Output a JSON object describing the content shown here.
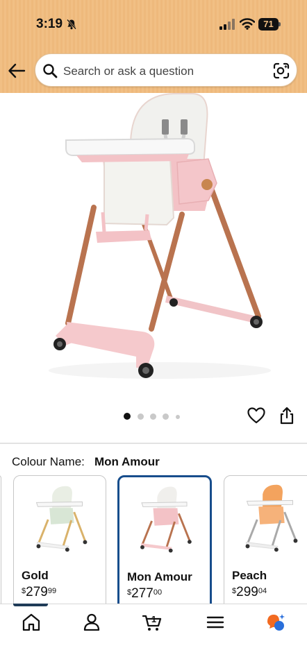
{
  "status_bar": {
    "time": "3:19",
    "battery_level": "71",
    "icons": [
      "bell-slash-icon",
      "cellular-signal-icon",
      "wifi-icon",
      "battery-icon"
    ]
  },
  "header": {
    "back_icon": "back-arrow-icon",
    "search_placeholder": "Search or ask a question",
    "search_icon": "search-icon",
    "camera_icon": "camera-search-icon"
  },
  "product_gallery": {
    "image_count": 5,
    "active_index": 0,
    "actions": [
      "heart-icon",
      "share-icon"
    ]
  },
  "colour": {
    "label": "Colour Name:",
    "selected": "Mon Amour"
  },
  "swatches": [
    {
      "name": "Gold",
      "currency": "$",
      "whole": "279",
      "fraction": "99",
      "selected": false,
      "accent": "#d9b26a"
    },
    {
      "name": "Mon Amour",
      "currency": "$",
      "whole": "277",
      "fraction": "00",
      "selected": true,
      "accent": "#f2c6c8"
    },
    {
      "name": "Peach",
      "currency": "$",
      "whole": "299",
      "fraction": "04",
      "selected": false,
      "accent": "#f3a35e"
    }
  ],
  "bottom_nav": {
    "items": [
      "home-icon",
      "account-icon",
      "cart-icon",
      "menu-icon",
      "rufus-assistant-icon"
    ],
    "cart_count": "1",
    "active": "home-icon"
  },
  "colors": {
    "header_bg": "#f1bf84",
    "selected_border": "#174d8c",
    "chair_pink": "#f5c9cc",
    "rose_gold": "#b9734f"
  }
}
